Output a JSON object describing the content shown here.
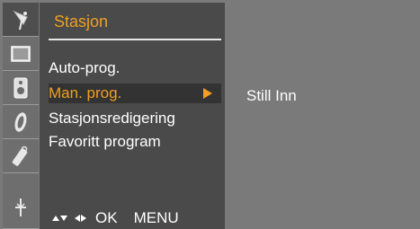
{
  "panel": {
    "title": "Stasjon"
  },
  "menu": {
    "items": [
      {
        "label": "Auto-prog.",
        "selected": false
      },
      {
        "label": "Man. prog.",
        "selected": true
      },
      {
        "label": "Stasjonsredigering",
        "selected": false
      },
      {
        "label": "Favoritt program",
        "selected": false
      }
    ]
  },
  "submenu": {
    "label": "Still Inn"
  },
  "footer": {
    "ok_label": "OK",
    "menu_label": "MENU"
  },
  "sidebar": {
    "icons": [
      {
        "name": "satellite-dish-icon",
        "active": true
      },
      {
        "name": "picture-icon",
        "active": false
      },
      {
        "name": "sound-icon",
        "active": false
      },
      {
        "name": "time-icon",
        "active": false
      },
      {
        "name": "options-icon",
        "active": false
      },
      {
        "name": "input-icon",
        "active": false
      }
    ]
  },
  "colors": {
    "accent": "#f0a020",
    "panel_bg": "#4a4a4a",
    "screen_bg": "#7a7a7a",
    "text": "#ffffff"
  }
}
